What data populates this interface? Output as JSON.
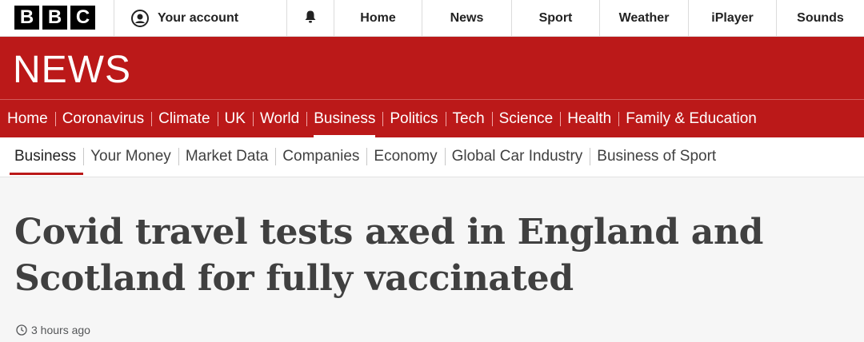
{
  "topbar": {
    "logo": [
      "B",
      "B",
      "C"
    ],
    "account_label": "Your account",
    "nav": [
      "Home",
      "News",
      "Sport",
      "Weather",
      "iPlayer",
      "Sounds"
    ]
  },
  "masthead": {
    "title": "NEWS",
    "nav": [
      "Home",
      "Coronavirus",
      "Climate",
      "UK",
      "World",
      "Business",
      "Politics",
      "Tech",
      "Science",
      "Health",
      "Family & Education"
    ],
    "active": "Business"
  },
  "subnav": {
    "items": [
      "Business",
      "Your Money",
      "Market Data",
      "Companies",
      "Economy",
      "Global Car Industry",
      "Business of Sport"
    ],
    "active": "Business"
  },
  "article": {
    "headline": "Covid travel tests axed in England and Scotland for fully vaccinated",
    "timestamp": "3 hours ago"
  },
  "colors": {
    "brand_red": "#bb1919",
    "accent_red": "#bb1919",
    "text_dark": "#404040"
  },
  "icons": {
    "account": "account-icon",
    "notifications": "bell-icon",
    "timestamp": "clock-icon"
  }
}
